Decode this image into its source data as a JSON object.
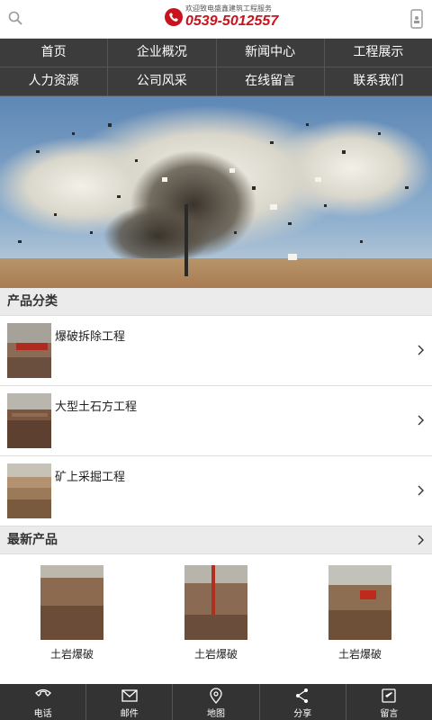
{
  "header": {
    "slogan": "欢迎致电盛鑫建筑工程服务",
    "phone": "0539-5012557"
  },
  "nav": {
    "row1": [
      "首页",
      "企业概况",
      "新闻中心",
      "工程展示"
    ],
    "row2": [
      "人力资源",
      "公司风采",
      "在线留言",
      "联系我们"
    ]
  },
  "categories": {
    "title": "产品分类",
    "items": [
      {
        "label": "爆破拆除工程"
      },
      {
        "label": "大型土石方工程"
      },
      {
        "label": "矿上采掘工程"
      }
    ]
  },
  "latest": {
    "title": "最新产品",
    "items": [
      {
        "caption": "土岩爆破"
      },
      {
        "caption": "土岩爆破"
      },
      {
        "caption": "土岩爆破"
      }
    ]
  },
  "footer": {
    "items": [
      {
        "label": "电话",
        "icon": "phone-icon"
      },
      {
        "label": "邮件",
        "icon": "mail-icon"
      },
      {
        "label": "地图",
        "icon": "map-pin-icon"
      },
      {
        "label": "分享",
        "icon": "share-icon"
      },
      {
        "label": "留言",
        "icon": "message-icon"
      }
    ]
  },
  "colors": {
    "brand_red": "#c8141c",
    "nav_bg": "#3c3c3c",
    "footer_bg": "#333333",
    "section_bg": "#ebebeb"
  }
}
